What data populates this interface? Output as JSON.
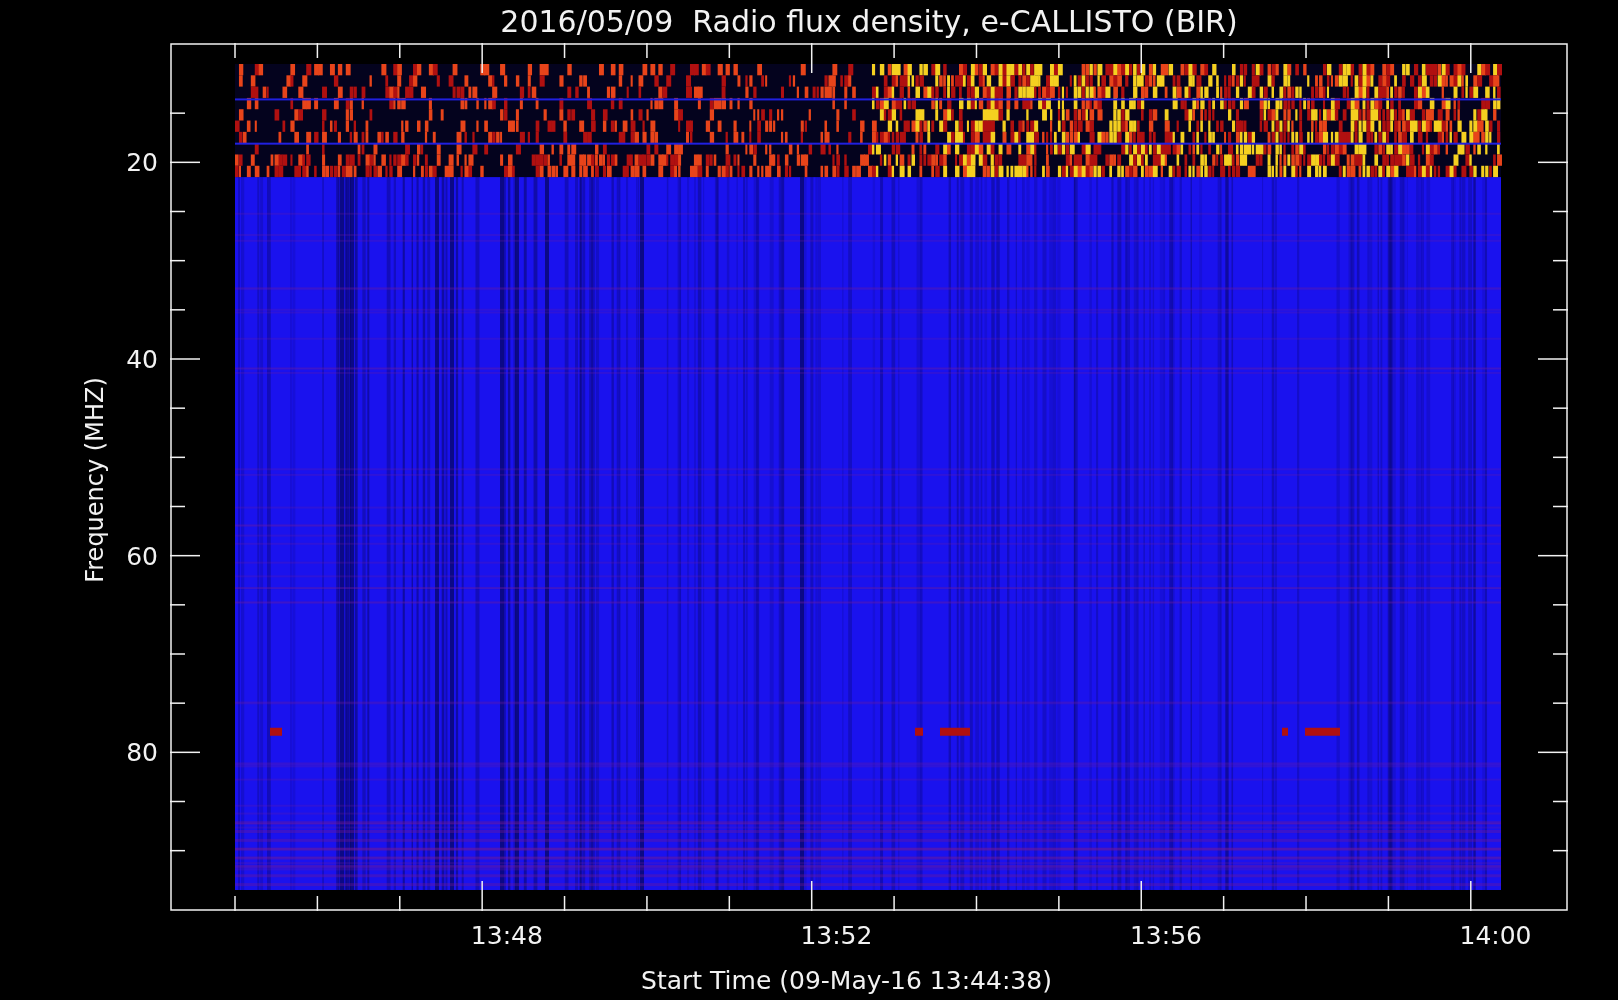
{
  "title": "2016/05/09  Radio flux density, e-CALLISTO (BIR)",
  "y_axis": {
    "label": "Frequency (MHZ)",
    "ticks": [
      "20",
      "40",
      "60",
      "80"
    ]
  },
  "x_axis": {
    "label": "Start Time (09-May-16 13:44:38)",
    "ticks": [
      "13:48",
      "13:52",
      "13:56",
      "14:00"
    ]
  }
}
